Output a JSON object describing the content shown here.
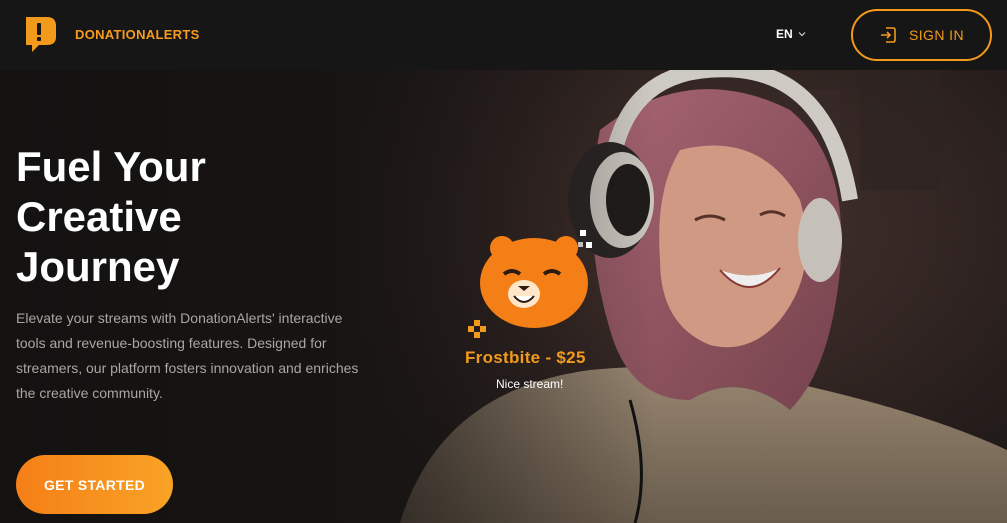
{
  "header": {
    "brand": "DONATIONALERTS",
    "language": "EN",
    "sign_in_label": "SIGN IN"
  },
  "hero": {
    "title_lines": [
      "Fuel Your",
      "Creative",
      "Journey"
    ],
    "description": "Elevate your streams with DonationAlerts' interactive tools and revenue-boosting features. Designed for streamers, our platform fosters innovation and enriches the creative community.",
    "cta_label": "GET STARTED"
  },
  "alert": {
    "name_amount": "Frostbite - $25",
    "message": "Nice stream!"
  },
  "colors": {
    "accent": "#f29a1c",
    "cta_gradient_start": "#f57f17",
    "cta_gradient_end": "#f8a326",
    "header_bg": "#161616"
  },
  "icons": {
    "logo": "donationalerts-logo-icon",
    "language_chevron": "chevron-down-icon",
    "sign_in": "sign-in-icon",
    "mascot": "bear-mascot-icon"
  }
}
